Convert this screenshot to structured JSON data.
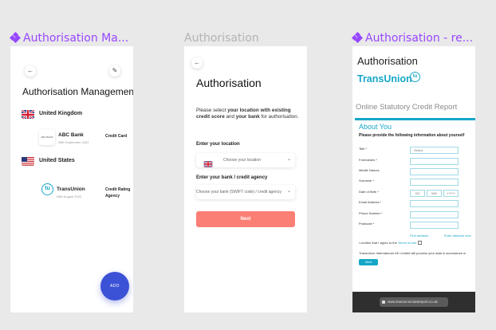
{
  "frames": [
    {
      "label": "Authorisation Ma...",
      "is_component": true
    },
    {
      "label": "Authorisation",
      "is_component": false
    },
    {
      "label": "Authorisation - re...",
      "is_component": true
    }
  ],
  "colors": {
    "component": "#9747ff",
    "primary": "#3b52d6",
    "accent": "#fb7f75",
    "transunion": "#16a7c8"
  },
  "screen1": {
    "back_icon": "arrow-left-icon",
    "edit_icon": "external-edit-icon",
    "title": "Authorisation Management",
    "countries": [
      {
        "name": "United Kingdom",
        "flag": "uk-flag-icon"
      },
      {
        "name": "United States",
        "flag": "us-flag-icon"
      }
    ],
    "entries": [
      {
        "logo_text": "ABC BANK",
        "name": "ABC Bank",
        "date": "08th September 2022",
        "type": "Credit Card"
      },
      {
        "logo_text": "tu",
        "name": "TransUnion",
        "date": "08th August 2022",
        "type": "Credit Rating Agency"
      }
    ],
    "add_label": "ADD"
  },
  "screen2": {
    "back_icon": "arrow-left-icon",
    "title": "Authorisation",
    "desc_part1": "Please select ",
    "desc_bold1": "your location with existing credit score",
    "desc_part2": " and ",
    "desc_bold2": "your bank",
    "desc_part3": " for authorisation.",
    "location_label": "Enter your location",
    "location_placeholder": "Choose your location",
    "bank_label": "Enter your bank / credit agency",
    "bank_placeholder": "Choose your bank (SWIFT code) / credit agency",
    "next_label": "Next"
  },
  "screen3": {
    "title": "Authorisation",
    "brand": "TransUnion",
    "brand_badge": "tu",
    "report_title": "Online Statutory Credit Report",
    "about_title": "About You",
    "prompt": "Please provide the following information about yourself",
    "fields": [
      {
        "label": "Title *",
        "value": "Select"
      },
      {
        "label": "Forenames *",
        "value": ""
      },
      {
        "label": "Middle Names",
        "value": ""
      },
      {
        "label": "Surname *",
        "value": ""
      },
      {
        "label": "Date of Birth *",
        "value": ""
      },
      {
        "label": "Email Address *",
        "value": ""
      },
      {
        "label": "Phone Number *",
        "value": ""
      },
      {
        "label": "Postcode *",
        "value": ""
      }
    ],
    "dob": {
      "dd": "DD",
      "mm": "MM",
      "yyyy": "YYYY"
    },
    "find_address": "Find address",
    "enter_address": "Enter address man",
    "confirm_text": "I confirm that I agree to the ",
    "terms_link": "Terms of Use",
    "note": "TransUnion International UK Limited will process your data in accordance w",
    "start_label": "Next",
    "url": "www.transunionstatreport.co.uk"
  }
}
